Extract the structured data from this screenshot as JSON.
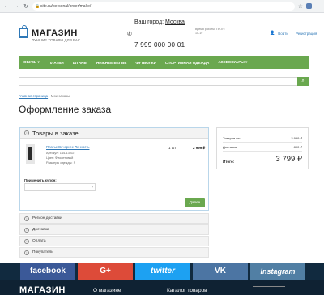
{
  "browser": {
    "url": "site.ru/personal/order/make/"
  },
  "header": {
    "logo_title": "МАГАЗИН",
    "logo_subtitle": "ЛУЧШИЕ ТОВАРЫ ДЛЯ ВАС",
    "city_label": "Ваш город:",
    "city_name": "Москва",
    "phone": "7 999 000 00 01",
    "hours": "Время работы: Пн-Пт: 10-19",
    "login": "Войти",
    "register": "Регистрация"
  },
  "menu": {
    "items": [
      "ОБУВЬ ▾",
      "ПЛАТЬЯ",
      "ШТАНЫ",
      "НИЖНЕЕ БЕЛЬЕ",
      "ФУТБОЛКИ",
      "СПОРТИВНАЯ ОДЕЖДА",
      "АКСЕССУАРЫ ▾"
    ]
  },
  "search": {
    "placeholder": ""
  },
  "breadcrumbs": {
    "home": "Главная страница",
    "separator": "›",
    "current": "Мои заказы"
  },
  "page": {
    "title": "Оформление заказа"
  },
  "cart": {
    "heading": "Товары в заказе",
    "item": {
      "name": "Платье Вечернее Ленность",
      "article_label": "Артикул:",
      "article": "144-13-02",
      "color_label": "Цвет:",
      "color": "Фиолетовый",
      "size_label": "Размеры одежды:",
      "size": "S",
      "qty": "1 шт",
      "price": "2 999 ₽"
    },
    "coupon_label": "Применить купон:",
    "next_button": "Далее"
  },
  "sections": [
    "Регион доставки",
    "Доставка",
    "Оплата",
    "Покупатель"
  ],
  "summary": {
    "goods_label": "Товаров на:",
    "goods_value": "2 999 ₽",
    "delivery_label": "Доставка:",
    "delivery_value": "800 ₽",
    "total_label": "Итого:",
    "total_value": "3 799 ₽"
  },
  "social": {
    "facebook": "facebook",
    "google": "G+",
    "twitter": "twitter",
    "vk": "VK",
    "instagram": "Instagram"
  },
  "footer": {
    "logo": "МАГАЗИН",
    "about": "О магазине",
    "catalog": "Каталог товаров"
  },
  "colors": {
    "accent_green": "#6aa84f",
    "link_blue": "#2e78b7",
    "footer_dark": "#0f2233"
  }
}
